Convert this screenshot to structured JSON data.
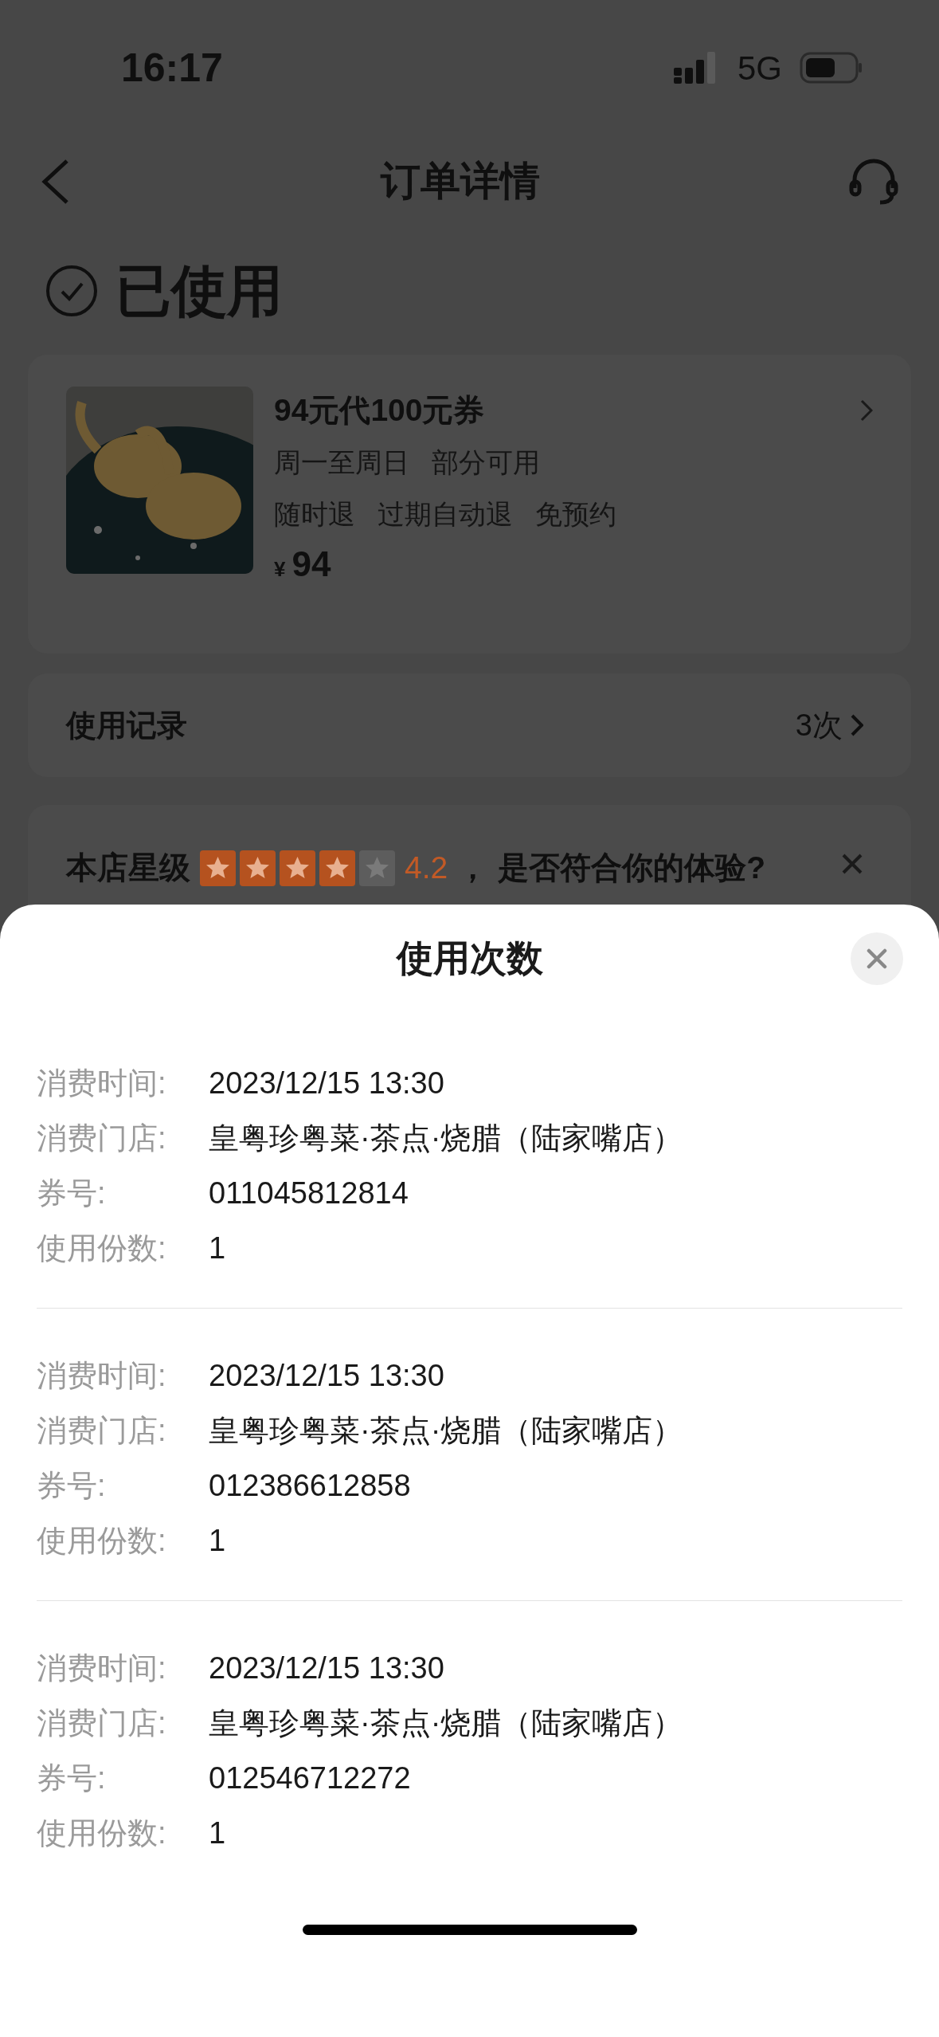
{
  "status_bar": {
    "time": "16:17",
    "network": "5G"
  },
  "nav": {
    "title": "订单详情"
  },
  "order_status": {
    "label": "已使用"
  },
  "deal": {
    "title": "94元代100元券",
    "line_1": [
      "周一至周日",
      "部分可用"
    ],
    "line_2": [
      "随时退",
      "过期自动退",
      "免预约"
    ],
    "currency": "¥",
    "price": "94"
  },
  "usage": {
    "label": "使用记录",
    "count": "3次"
  },
  "rating": {
    "prefix": "本店星级",
    "stars": 4,
    "score": "4.2",
    "comma": "，",
    "question": "是否符合你的体验?"
  },
  "sheet": {
    "title": "使用次数",
    "records": [
      {
        "fields": [
          {
            "label": "消费时间:",
            "value": "2023/12/15 13:30"
          },
          {
            "label": "消费门店:",
            "value": "皇粤珍粤菜·茶点·烧腊（陆家嘴店）"
          },
          {
            "label": "券号:",
            "value": "011045812814"
          },
          {
            "label": "使用份数:",
            "value": "1"
          }
        ]
      },
      {
        "fields": [
          {
            "label": "消费时间:",
            "value": "2023/12/15 13:30"
          },
          {
            "label": "消费门店:",
            "value": "皇粤珍粤菜·茶点·烧腊（陆家嘴店）"
          },
          {
            "label": "券号:",
            "value": "012386612858"
          },
          {
            "label": "使用份数:",
            "value": "1"
          }
        ]
      },
      {
        "fields": [
          {
            "label": "消费时间:",
            "value": "2023/12/15 13:30"
          },
          {
            "label": "消费门店:",
            "value": "皇粤珍粤菜·茶点·烧腊（陆家嘴店）"
          },
          {
            "label": "券号:",
            "value": "012546712272"
          },
          {
            "label": "使用份数:",
            "value": "1"
          }
        ]
      }
    ]
  }
}
